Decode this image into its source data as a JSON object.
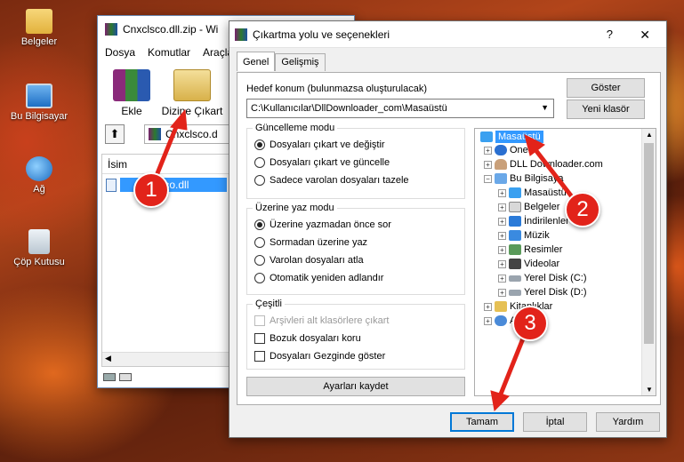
{
  "desktop": {
    "icons": [
      {
        "label": "Belgeler",
        "icon": "documents-folder-icon"
      },
      {
        "label": "Bu Bilgisayar",
        "icon": "computer-icon"
      },
      {
        "label": "Ağ",
        "icon": "network-icon"
      },
      {
        "label": "Çöp Kutusu",
        "icon": "recycle-bin-icon"
      }
    ]
  },
  "winrar": {
    "title": "Cnxclsco.dll.zip - Wi",
    "menu": [
      "Dosya",
      "Komutlar",
      "Araçla"
    ],
    "toolbar": {
      "add_label": "Ekle",
      "extract_label": "Dizine Çıkart"
    },
    "address": "Cnxclsco.d",
    "column_name": "İsim",
    "file": "cnxclsco.dll",
    "colors": {
      "title": "#000000",
      "selection": "#3399ff"
    }
  },
  "dialog": {
    "title": "Çıkartma yolu ve seçenekleri",
    "help": "?",
    "close": "✕",
    "tabs": [
      "Genel",
      "Gelişmiş"
    ],
    "dest_label": "Hedef konum (bulunmazsa oluşturulacak)",
    "dest_value": "C:\\Kullanıcılar\\DllDownloader_com\\Masaüstü",
    "show_button": "Göster",
    "new_folder_button": "Yeni klasör",
    "update_mode": {
      "title": "Güncelleme modu",
      "options": [
        "Dosyaları çıkart ve değiştir",
        "Dosyaları çıkart ve güncelle",
        "Sadece varolan dosyaları tazele"
      ],
      "selected": 0
    },
    "overwrite_mode": {
      "title": "Üzerine yaz modu",
      "options": [
        "Üzerine yazmadan önce sor",
        "Sormadan üzerine yaz",
        "Varolan dosyaları atla",
        "Otomatik yeniden adlandır"
      ],
      "selected": 0
    },
    "misc": {
      "title": "Çeşitli",
      "options": [
        "Arşivleri alt klasörlere çıkart",
        "Bozuk dosyaları koru",
        "Dosyaları Gezginde göster"
      ]
    },
    "save_settings": "Ayarları kaydet",
    "tree": [
      {
        "label": "Masaüstü",
        "selected": true
      },
      {
        "label": "OneDr"
      },
      {
        "label": "DLL Downloader.com"
      },
      {
        "label": "Bu Bilgisaya"
      },
      {
        "label": "Masaüstü"
      },
      {
        "label": "Belgeler"
      },
      {
        "label": "İndirilenler"
      },
      {
        "label": "Müzik"
      },
      {
        "label": "Resimler"
      },
      {
        "label": "Videolar"
      },
      {
        "label": "Yerel Disk (C:)"
      },
      {
        "label": "Yerel Disk (D:)"
      },
      {
        "label": "Kitaplıklar"
      },
      {
        "label": "Ağ"
      }
    ],
    "ok": "Tamam",
    "cancel": "İptal",
    "help_button": "Yardım"
  },
  "callouts": [
    "1",
    "2",
    "3"
  ],
  "colors": {
    "callout": "#e2231a",
    "selection": "#3399ff",
    "dialog_bg": "#f0f0f0"
  }
}
